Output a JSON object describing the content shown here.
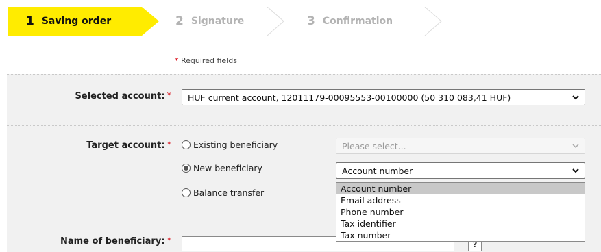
{
  "stepper": {
    "steps": [
      {
        "number": "1",
        "label": "Saving order"
      },
      {
        "number": "2",
        "label": "Signature"
      },
      {
        "number": "3",
        "label": "Confirmation"
      }
    ],
    "active_color": "#ffec00",
    "inactive_color": "#b3b3b3"
  },
  "required_note": {
    "star": "*",
    "text": "Required fields"
  },
  "selected_account": {
    "label": "Selected account:",
    "star": "*",
    "value": "HUF current account, 12011179-00095553-00100000 (50 310 083,41 HUF)"
  },
  "target_account": {
    "label": "Target account:",
    "star": "*",
    "options": [
      {
        "label": "Existing beneficiary",
        "checked": false
      },
      {
        "label": "New beneficiary",
        "checked": true
      },
      {
        "label": "Balance transfer",
        "checked": false
      }
    ],
    "existing_select": {
      "placeholder": "Please select..."
    },
    "new_select": {
      "value": "Account number",
      "options": [
        "Account number",
        "Email address",
        "Phone number",
        "Tax identifier",
        "Tax number"
      ]
    }
  },
  "beneficiary_name": {
    "label": "Name of beneficiary:",
    "star": "*",
    "value": "",
    "help": "?"
  },
  "colors": {
    "required_star": "#d9000d",
    "form_background": "#f1f1f1"
  }
}
